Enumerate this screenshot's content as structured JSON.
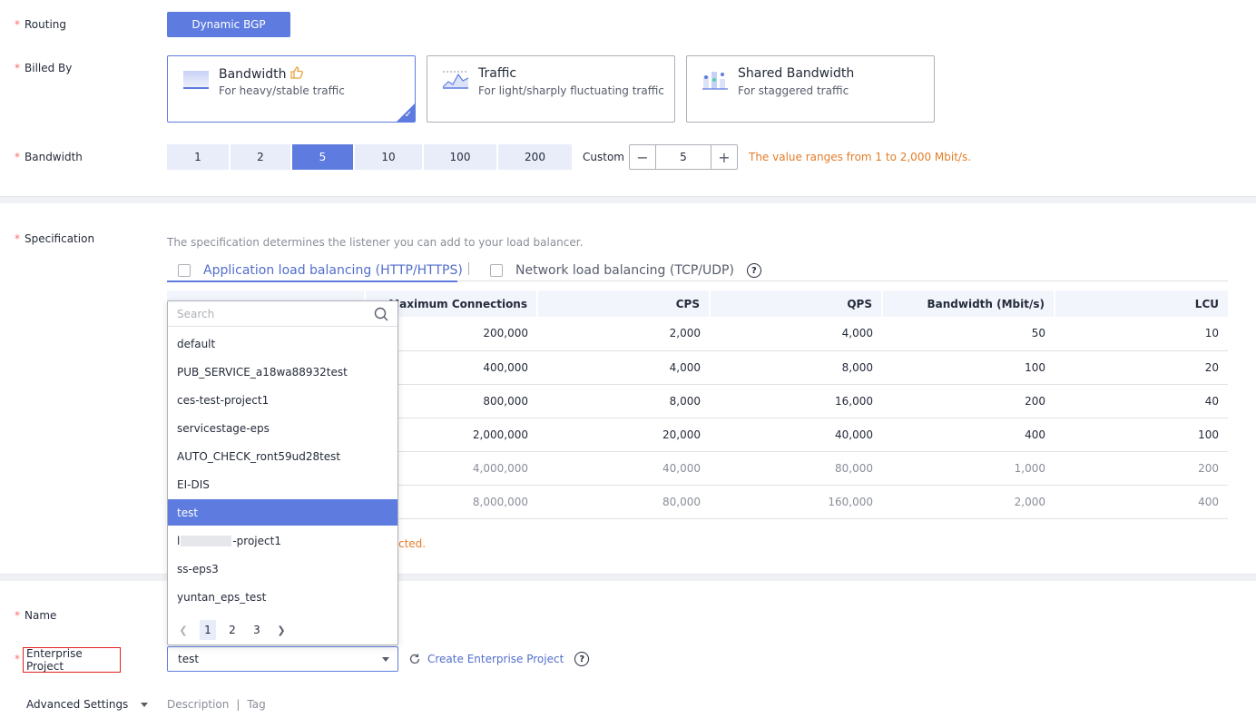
{
  "routing": {
    "label": "Routing",
    "value": "Dynamic BGP"
  },
  "billed_by": {
    "label": "Billed By",
    "options": [
      {
        "title": "Bandwidth",
        "subtitle": "For heavy/stable traffic",
        "icon": "bandwidth-icon",
        "selected": true
      },
      {
        "title": "Traffic",
        "subtitle": "For light/sharply fluctuating traffic",
        "icon": "traffic-icon",
        "selected": false
      },
      {
        "title": "Shared Bandwidth",
        "subtitle": "For staggered traffic",
        "icon": "shared-bandwidth-icon",
        "selected": false
      }
    ]
  },
  "bandwidth": {
    "label": "Bandwidth",
    "options": [
      "1",
      "2",
      "5",
      "10",
      "100",
      "200"
    ],
    "selected": "5",
    "custom_label": "Custom",
    "custom_value": "5",
    "hint": "The value ranges from 1 to 2,000 Mbit/s."
  },
  "specification": {
    "label": "Specification",
    "description": "The specification determines the listener you can add to your load balancer.",
    "tabs": [
      {
        "label": "Application load balancing (HTTP/HTTPS)",
        "active": true
      },
      {
        "label": "Network load balancing (TCP/UDP)",
        "active": false
      }
    ],
    "columns": [
      "Maximum Connections",
      "CPS",
      "QPS",
      "Bandwidth (Mbit/s)",
      "LCU"
    ],
    "rows": [
      [
        "200,000",
        "2,000",
        "4,000",
        "50",
        "10"
      ],
      [
        "400,000",
        "4,000",
        "8,000",
        "100",
        "20"
      ],
      [
        "800,000",
        "8,000",
        "16,000",
        "200",
        "40"
      ],
      [
        "2,000,000",
        "20,000",
        "40,000",
        "400",
        "100"
      ],
      [
        "4,000,000",
        "40,000",
        "80,000",
        "1,000",
        "200"
      ],
      [
        "8,000,000",
        "80,000",
        "160,000",
        "2,000",
        "400"
      ]
    ],
    "warning_tail": "cted."
  },
  "dropdown": {
    "search_placeholder": "Search",
    "options": [
      "default",
      "PUB_SERVICE_a18wa88932test",
      "ces-test-project1",
      "servicestage-eps",
      "AUTO_CHECK_ront59ud28test",
      "EI-DIS",
      "test",
      "l",
      "ss-eps3",
      "yuntan_eps_test"
    ],
    "redacted_option_suffix": "-project1",
    "selected": "test",
    "pages": [
      "1",
      "2",
      "3"
    ],
    "current_page": "1"
  },
  "name": {
    "label": "Name"
  },
  "enterprise_project": {
    "label": "Enterprise Project",
    "value": "test",
    "create_link": "Create Enterprise Project"
  },
  "advanced": {
    "label": "Advanced Settings",
    "items": [
      "Description",
      "Tag"
    ],
    "separator": "|"
  },
  "colors": {
    "accent": "#5e7ce0",
    "required": "#f66f6a",
    "warning": "#e37d29",
    "highlight_box": "#e2221a"
  }
}
